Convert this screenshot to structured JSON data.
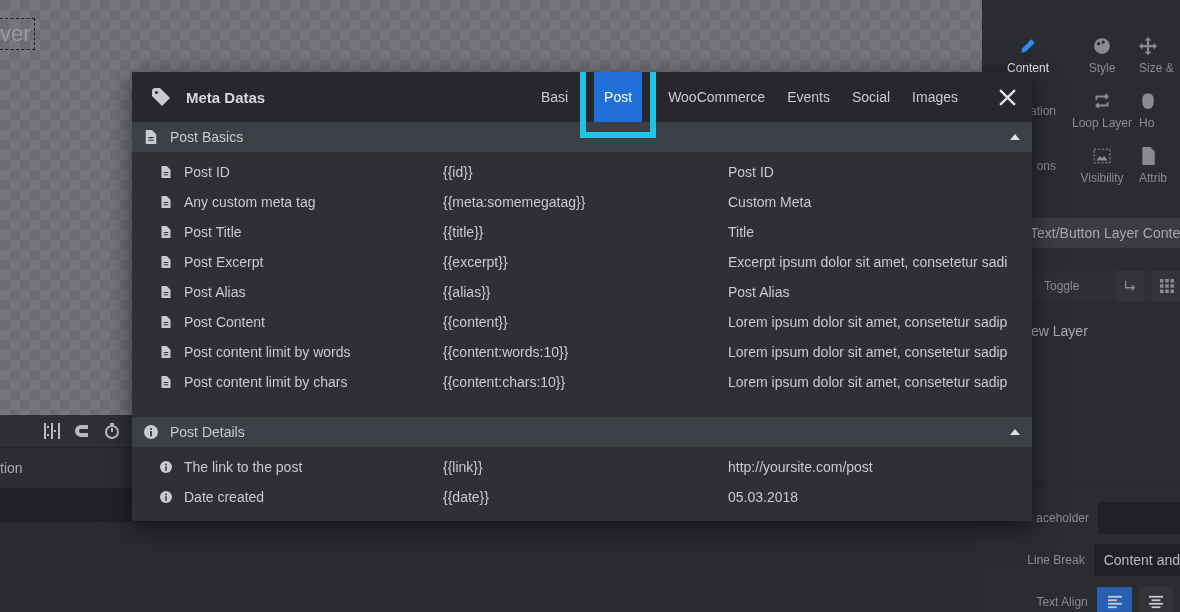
{
  "canvas": {
    "layer_label": "ver"
  },
  "timeline": {
    "column_label": "tion"
  },
  "sidebar": {
    "tabs": [
      {
        "label": "Content",
        "selected": true
      },
      {
        "label": "Style",
        "selected": false
      },
      {
        "label": "Size &",
        "selected": false
      },
      {
        "label": "ation",
        "selected": false
      },
      {
        "label": "Loop Layer",
        "selected": false
      },
      {
        "label": "Ho",
        "selected": false
      },
      {
        "label": "ons",
        "selected": false
      },
      {
        "label": "Visibility",
        "selected": false
      },
      {
        "label": "Attrib",
        "selected": false
      }
    ],
    "section_title": "Text/Button Layer Conte",
    "toggle": "Toggle",
    "layer_name": "ew Layer",
    "fields": [
      {
        "label": "aceholder"
      },
      {
        "label": "Line Break",
        "value": "Content and"
      },
      {
        "label": "Text Align"
      }
    ],
    "align_buttons": [
      {
        "selected": true
      },
      {
        "selected": false
      }
    ]
  },
  "modal": {
    "title": "Meta Datas",
    "tabs": [
      {
        "label": "Basi",
        "selected": false,
        "highlighted": false
      },
      {
        "label": "Post",
        "selected": true,
        "highlighted": true
      },
      {
        "label": "WooCommerce",
        "selected": false,
        "highlighted": false
      },
      {
        "label": "Events",
        "selected": false,
        "highlighted": false
      },
      {
        "label": "Social",
        "selected": false,
        "highlighted": false
      },
      {
        "label": "Images",
        "selected": false,
        "highlighted": false
      }
    ],
    "sections": [
      {
        "title": "Post Basics",
        "kind": "doc",
        "expanded": true,
        "rows": [
          {
            "name": "Post ID",
            "tag": "{{id}}",
            "example": "Post ID"
          },
          {
            "name": "Any custom meta tag",
            "tag": "{{meta:somemegatag}}",
            "example": "Custom Meta"
          },
          {
            "name": "Post Title",
            "tag": "{{title}}",
            "example": "Title"
          },
          {
            "name": "Post Excerpt",
            "tag": "{{excerpt}}",
            "example": "Excerpt ipsum dolor sit amet, consetetur sadi"
          },
          {
            "name": "Post Alias",
            "tag": "{{alias}}",
            "example": "Post Alias"
          },
          {
            "name": "Post Content",
            "tag": "{{content}}",
            "example": "Lorem ipsum dolor sit amet, consetetur sadip"
          },
          {
            "name": "Post content limit by words",
            "tag": "{{content:words:10}}",
            "example": "Lorem ipsum dolor sit amet, consetetur sadip"
          },
          {
            "name": "Post content limit by chars",
            "tag": "{{content:chars:10}}",
            "example": "Lorem ipsum dolor sit amet, consetetur sadip"
          }
        ]
      },
      {
        "title": "Post Details",
        "kind": "info",
        "expanded": true,
        "rows": [
          {
            "name": "The link to the post",
            "tag": "{{link}}",
            "example": "http://yoursite.com/post"
          },
          {
            "name": "Date created",
            "tag": "{{date}}",
            "example": "05.03.2018"
          }
        ]
      }
    ]
  }
}
